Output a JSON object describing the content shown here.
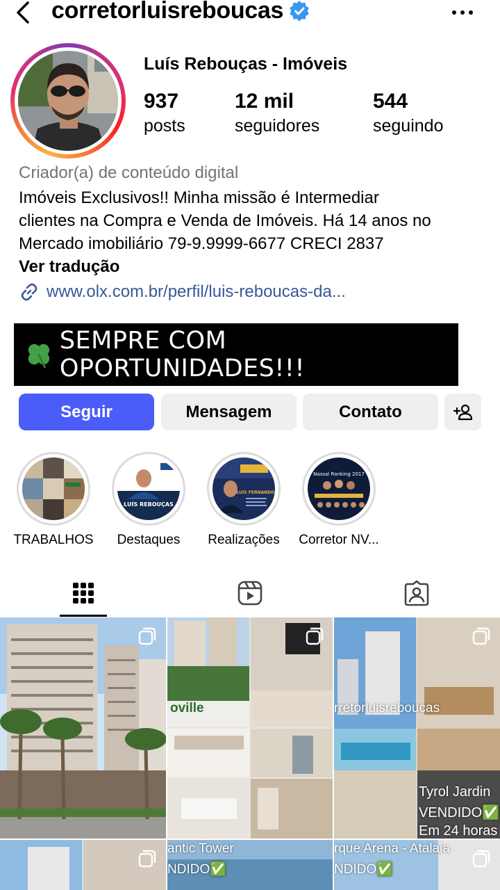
{
  "header": {
    "username": "corretorluisreboucas",
    "verified": true,
    "back_icon": "chevron-left-icon",
    "more_icon": "more-horizontal-icon"
  },
  "profile": {
    "display_name": "Luís Rebouças - Imóveis",
    "stats": [
      {
        "value": "937",
        "label": "posts"
      },
      {
        "value": "12 mil",
        "label": "seguidores"
      },
      {
        "value": "544",
        "label": "seguindo"
      }
    ],
    "category": "Criador(a) de conteúdo digital",
    "bio_lines": [
      "Imóveis Exclusivos!! Minha missão é Intermediar",
      "clientes na Compra e Venda de Imóveis. Há 14 anos no",
      "Mercado imobiliário 79-9.9999-6677 CRECI 2837"
    ],
    "translate_label": "Ver tradução",
    "link": "www.olx.com.br/perfil/luis-reboucas-da..."
  },
  "banner": {
    "text": "SEMPRE COM OPORTUNIDADES!!!",
    "icon": "four-leaf-clover-icon"
  },
  "actions": {
    "follow": "Seguir",
    "message": "Mensagem",
    "contact": "Contato",
    "add_user_icon": "add-person-icon",
    "follow_color": "#4a5df9"
  },
  "highlights": [
    {
      "label": "TRABALHOS"
    },
    {
      "label": "Destaques",
      "image_text": "LUÍS REBOUÇAS"
    },
    {
      "label": "Realizações",
      "image_text": "LUIS FERNANDO"
    },
    {
      "label": "Corretor NV...",
      "image_text": "Nassal Ranking 2017"
    }
  ],
  "tabs": [
    {
      "name": "grid",
      "icon": "grid-icon",
      "active": true
    },
    {
      "name": "reels",
      "icon": "reels-icon",
      "active": false
    },
    {
      "name": "tagged",
      "icon": "tagged-person-icon",
      "active": false
    }
  ],
  "posts": [
    {
      "overlay": []
    },
    {
      "overlay": [
        "oville"
      ]
    },
    {
      "overlay": [
        "rretorluisreboucas",
        "Tyrol Jardin",
        "VENDIDO✅",
        "Em 24 horas"
      ]
    },
    {
      "overlay": []
    },
    {
      "overlay": [
        "antic Tower",
        "NDIDO✅"
      ]
    },
    {
      "overlay": [
        "rque Arena - Atalaia",
        "NDIDO✅"
      ]
    }
  ]
}
